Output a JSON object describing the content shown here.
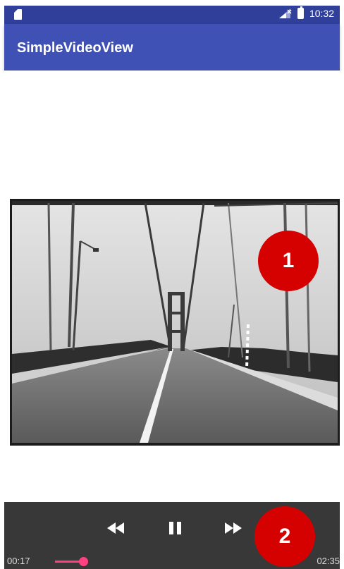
{
  "status_bar": {
    "time": "10:32"
  },
  "app_bar": {
    "title": "SimpleVideoView"
  },
  "callouts": {
    "video_badge": "1",
    "controls_badge": "2"
  },
  "player": {
    "current_time": "00:17",
    "total_time": "02:35",
    "progress_fraction": 0.11,
    "icons": {
      "rewind": "rewind-icon",
      "pause": "pause-icon",
      "fast_forward": "fast-forward-icon"
    }
  },
  "colors": {
    "app_bar": "#3f51b5",
    "status_bar": "#2f3f9a",
    "controls_bg": "#383838",
    "seek_accent": "#ff4081",
    "badge": "#d50000"
  }
}
